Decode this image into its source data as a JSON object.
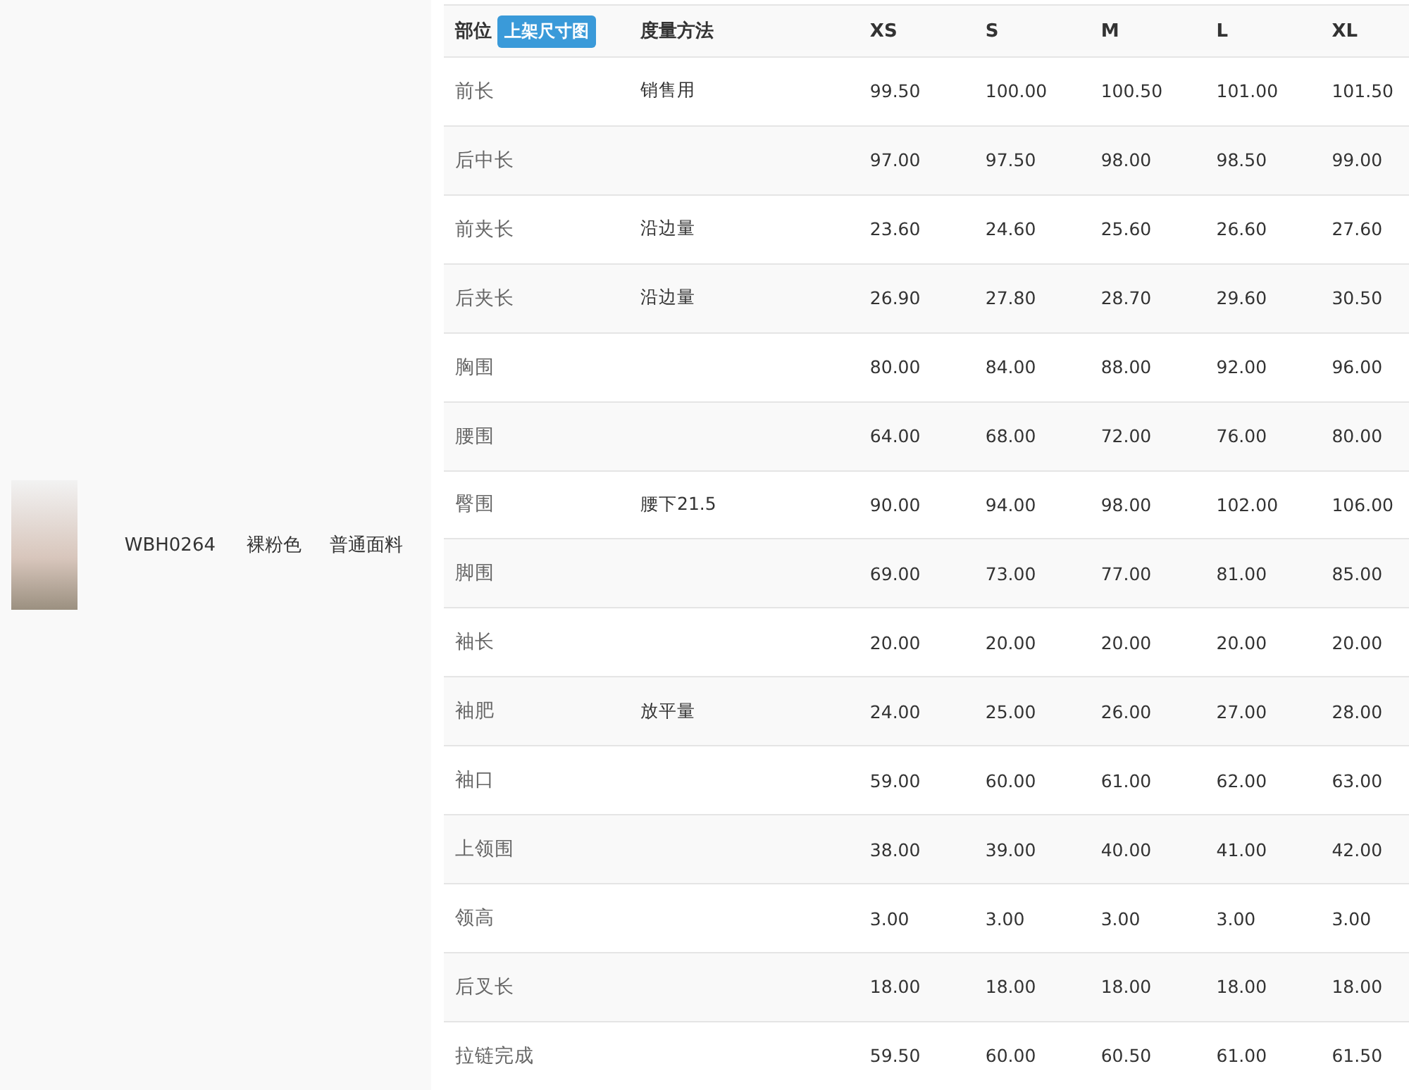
{
  "product": {
    "code": "WBH0264",
    "color_name": "裸粉色",
    "fabric": "普通面料"
  },
  "table": {
    "part_header": "部位",
    "badge": "上架尺寸图",
    "method_header": "度量方法",
    "sizes": [
      "XS",
      "S",
      "M",
      "L",
      "XL"
    ],
    "rows": [
      {
        "part": "前长",
        "method": "销售用",
        "values": [
          "99.50",
          "100.00",
          "100.50",
          "101.00",
          "101.50"
        ]
      },
      {
        "part": "后中长",
        "values": [
          "97.00",
          "97.50",
          "98.00",
          "98.50",
          "99.00"
        ]
      },
      {
        "part": "前夹长",
        "method": "沿边量",
        "values": [
          "23.60",
          "24.60",
          "25.60",
          "26.60",
          "27.60"
        ]
      },
      {
        "part": "后夹长",
        "method": "沿边量",
        "values": [
          "26.90",
          "27.80",
          "28.70",
          "29.60",
          "30.50"
        ]
      },
      {
        "part": "胸围",
        "values": [
          "80.00",
          "84.00",
          "88.00",
          "92.00",
          "96.00"
        ]
      },
      {
        "part": "腰围",
        "values": [
          "64.00",
          "68.00",
          "72.00",
          "76.00",
          "80.00"
        ]
      },
      {
        "part": "臀围",
        "method": "腰下21.5",
        "values": [
          "90.00",
          "94.00",
          "98.00",
          "102.00",
          "106.00"
        ]
      },
      {
        "part": "脚围",
        "values": [
          "69.00",
          "73.00",
          "77.00",
          "81.00",
          "85.00"
        ]
      },
      {
        "part": "袖长",
        "values": [
          "20.00",
          "20.00",
          "20.00",
          "20.00",
          "20.00"
        ]
      },
      {
        "part": "袖肥",
        "method": "放平量",
        "values": [
          "24.00",
          "25.00",
          "26.00",
          "27.00",
          "28.00"
        ]
      },
      {
        "part": "袖口",
        "values": [
          "59.00",
          "60.00",
          "61.00",
          "62.00",
          "63.00"
        ]
      },
      {
        "part": "上领围",
        "values": [
          "38.00",
          "39.00",
          "40.00",
          "41.00",
          "42.00"
        ]
      },
      {
        "part": "领高",
        "values": [
          "3.00",
          "3.00",
          "3.00",
          "3.00",
          "3.00"
        ]
      },
      {
        "part": "后叉长",
        "values": [
          "18.00",
          "18.00",
          "18.00",
          "18.00",
          "18.00"
        ]
      },
      {
        "part": "拉链完成",
        "values": [
          "59.50",
          "60.00",
          "60.50",
          "61.00",
          "61.50"
        ]
      }
    ]
  }
}
